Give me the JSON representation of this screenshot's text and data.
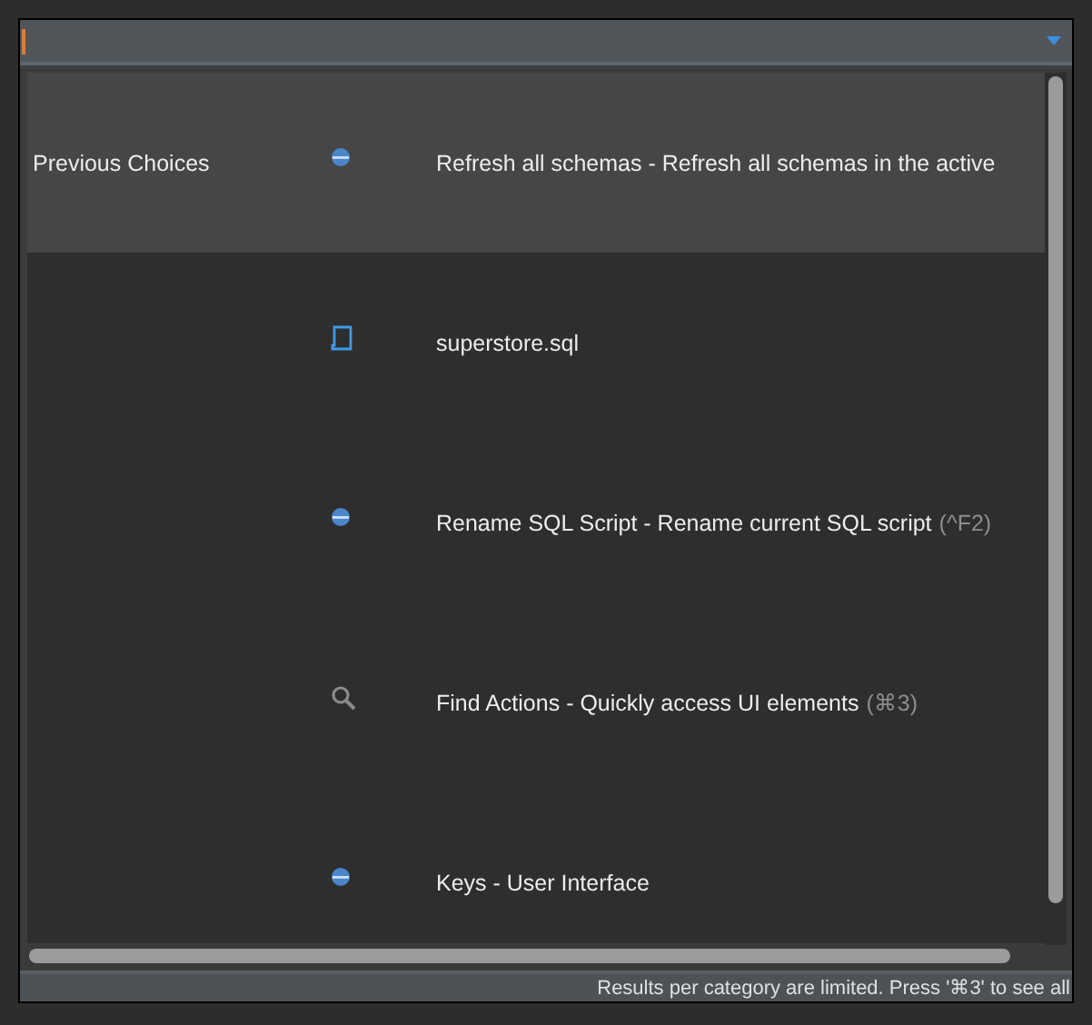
{
  "rows": [
    {
      "category": "Previous Choices",
      "kind": "action",
      "text": "Refresh all schemas - Refresh all schemas in the active",
      "selected": true
    },
    {
      "kind": "file",
      "text": "superstore.sql",
      "selected": false
    },
    {
      "kind": "action",
      "text": "Rename SQL Script - Rename current SQL script",
      "shortcut": "(^F2)",
      "selected": false
    },
    {
      "kind": "search",
      "text": "Find Actions - Quickly access UI elements",
      "shortcut": "(⌘3)",
      "selected": false
    },
    {
      "kind": "action",
      "text": "Keys - User Interface",
      "selected": false
    }
  ],
  "status_bar": "Results per category are limited. Press '⌘3' to see all"
}
